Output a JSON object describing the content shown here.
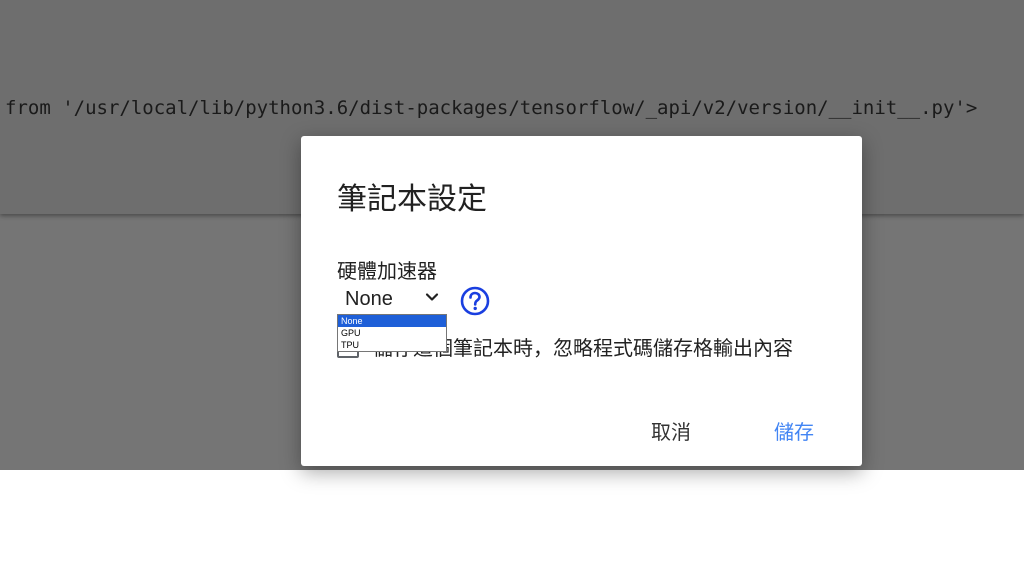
{
  "background": {
    "output_line": "from '/usr/local/lib/python3.6/dist-packages/tensorflow/_api/v2/version/__init__.py'>"
  },
  "dialog": {
    "title": "筆記本設定",
    "accelerator_label": "硬體加速器",
    "accelerator_value": "None",
    "accelerator_options": [
      "None",
      "GPU",
      "TPU"
    ],
    "help_icon": "help-circle-icon",
    "omit_output_label": "儲存這個筆記本時，忽略程式碼儲存格輸出內容",
    "omit_output_checked": false,
    "cancel_label": "取消",
    "save_label": "儲存"
  },
  "colors": {
    "accent": "#4285f4",
    "help_icon": "#1a3fe0",
    "selected_option": "#1e5fd8",
    "overlay": "#757575"
  }
}
